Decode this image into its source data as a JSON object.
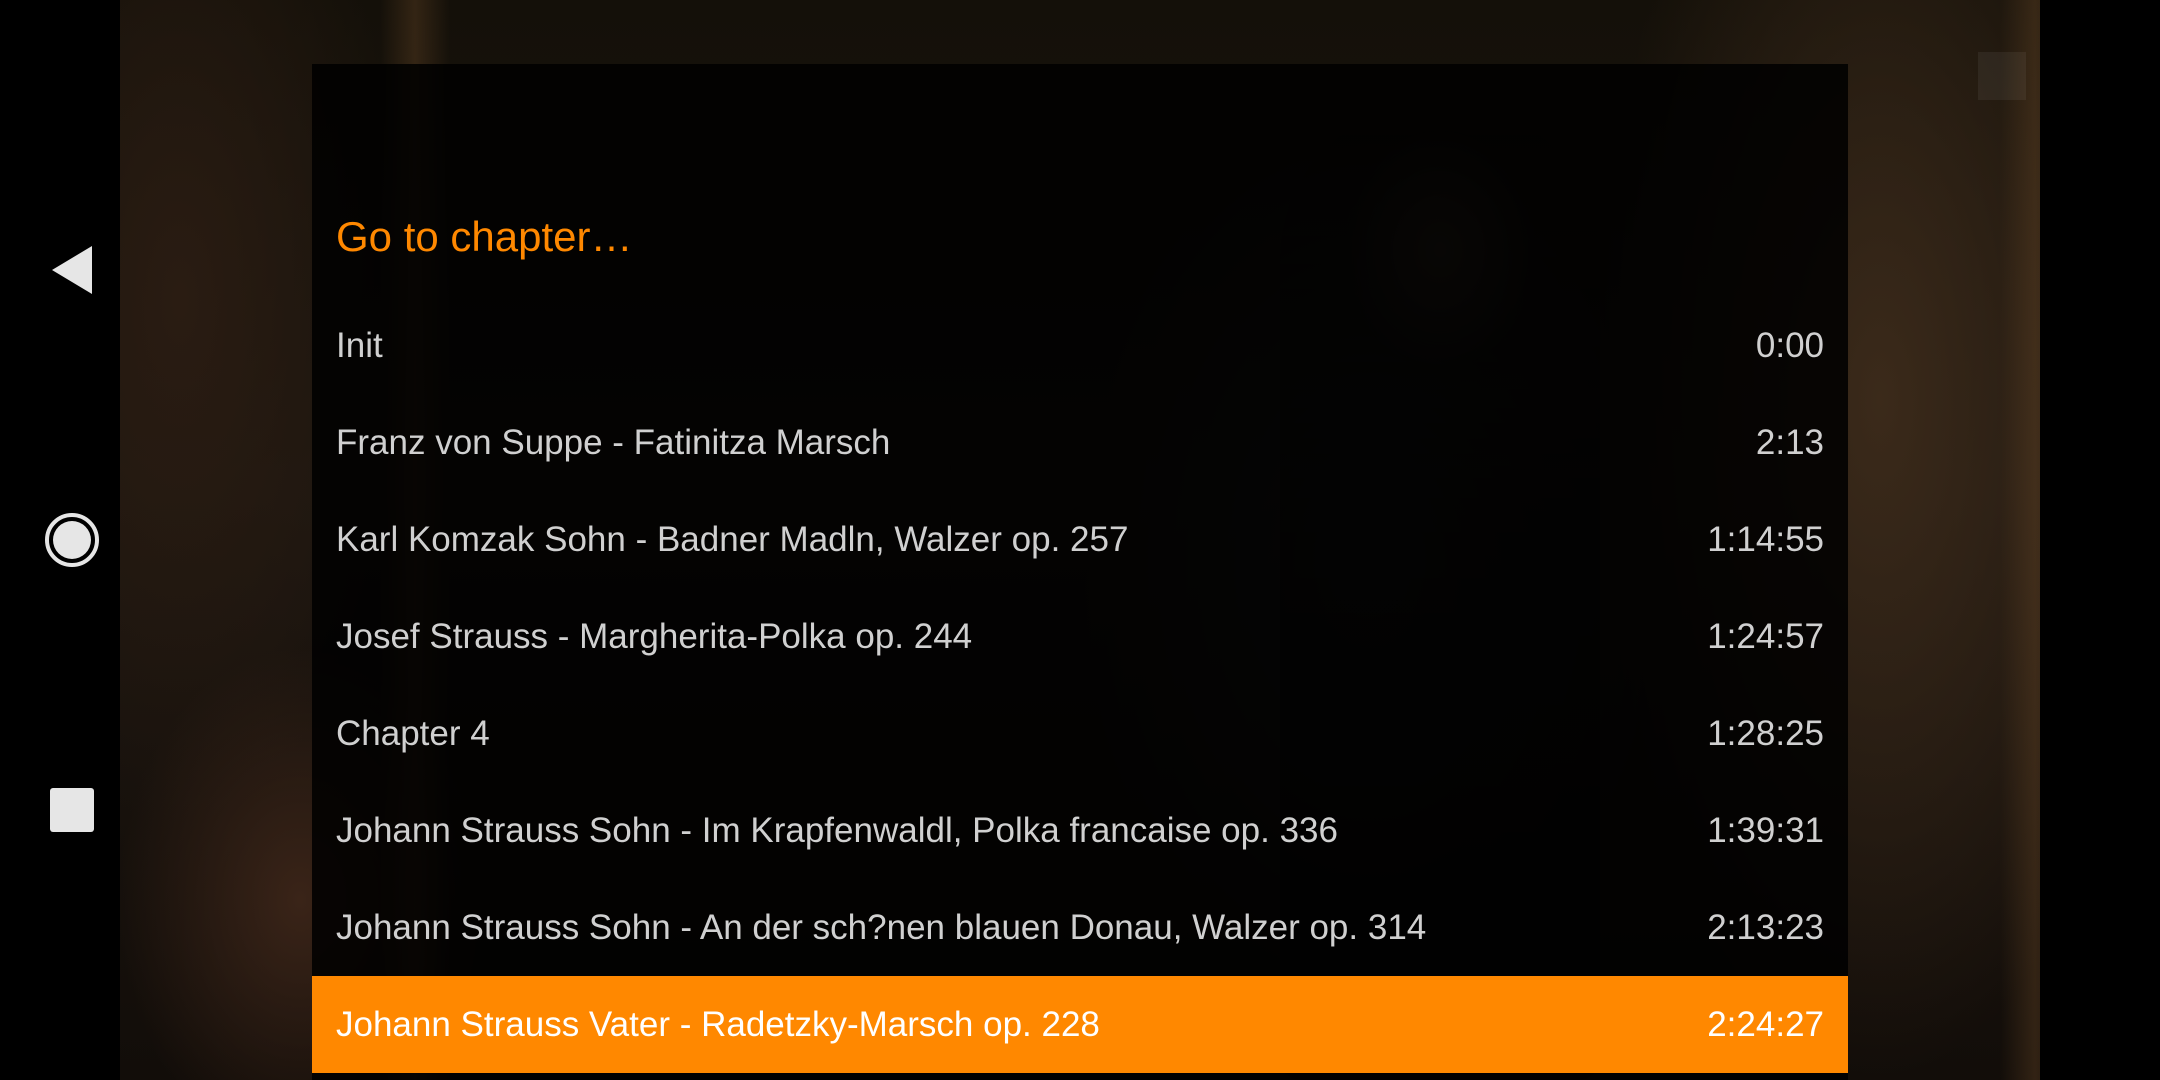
{
  "dialog": {
    "title": "Go to chapter…",
    "accent_color": "#ff8800",
    "chapters": [
      {
        "name": "Init",
        "time": "0:00",
        "selected": false
      },
      {
        "name": "Franz von Suppe - Fatinitza Marsch",
        "time": "2:13",
        "selected": false
      },
      {
        "name": "Karl Komzak Sohn - Badner Madln, Walzer op. 257",
        "time": "1:14:55",
        "selected": false
      },
      {
        "name": "Josef Strauss - Margherita-Polka op. 244",
        "time": "1:24:57",
        "selected": false
      },
      {
        "name": "Chapter 4",
        "time": "1:28:25",
        "selected": false
      },
      {
        "name": "Johann Strauss Sohn - Im Krapfenwaldl, Polka francaise op. 336",
        "time": "1:39:31",
        "selected": false
      },
      {
        "name": "Johann Strauss Sohn - An der sch?nen blauen Donau, Walzer op. 314",
        "time": "2:13:23",
        "selected": false
      },
      {
        "name": "Johann Strauss Vater - Radetzky-Marsch op. 228",
        "time": "2:24:27",
        "selected": true
      }
    ]
  },
  "navbar": {
    "icons": [
      "back-icon",
      "home-icon",
      "recents-icon"
    ]
  }
}
